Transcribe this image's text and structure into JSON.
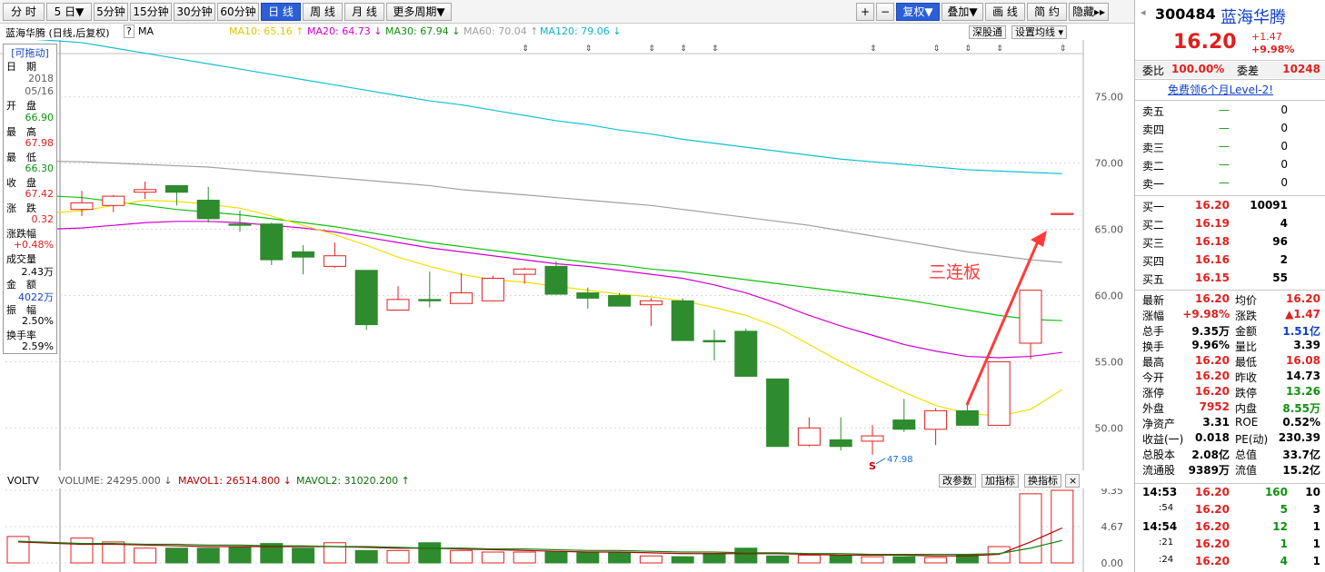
{
  "toolbar": {
    "periods": [
      "分 时",
      "5 日▼",
      "5分钟",
      "15分钟",
      "30分钟",
      "60分钟",
      "日 线",
      "周 线",
      "月 线",
      "更多周期▼"
    ],
    "active_period": 6,
    "right_buttons": [
      "+",
      "−",
      "复权▼",
      "叠加▼",
      "画 线",
      "简 约",
      "隐藏▸▸"
    ]
  },
  "stock": {
    "code": "300484",
    "name": "蓝海华腾",
    "price": "16.20",
    "change": "+1.47",
    "change_pct": "+9.98%"
  },
  "chart_header": {
    "title": "蓝海华腾 (日线,后复权)",
    "question": "?",
    "ma_label": "MA",
    "ma10": "MA10: 65.16 ↑",
    "ma20": "MA20: 64.73 ↓",
    "ma30": "MA30: 67.94 ↓",
    "ma60": "MA60: 70.04 ↑",
    "ma120": "MA120: 79.06 ↓",
    "btn_shengu": "深股通",
    "btn_ma_settings": "设置均线 ▾"
  },
  "info_panel": {
    "title": "[可拖动]",
    "date_label": "日　期",
    "year": "2018",
    "date": "05/16",
    "open_label": "开　盘",
    "open": "66.90",
    "high_label": "最　高",
    "high": "67.98",
    "low_label": "最　低",
    "low": "66.30",
    "close_label": "收　盘",
    "close": "67.42",
    "chg_label": "涨　跌",
    "chg": "0.32",
    "chgpct_label": "涨跌幅",
    "chgpct": "+0.48%",
    "vol_label": "成交量",
    "vol": "2.43万",
    "amt_label": "金　额",
    "amt": "4022万",
    "amp_label": "振　幅",
    "amp": "2.50%",
    "turn_label": "换手率",
    "turn": "2.59%"
  },
  "annotation": {
    "text": "三连板",
    "low_marker": "47.98",
    "s_marker": "S"
  },
  "vol_header": {
    "voltv": "VOLTV",
    "volume": "VOLUME: 24295.000 ↓",
    "mavol1": "MAVOL1: 26514.800 ↓",
    "mavol2": "MAVOL2: 31020.200 ↑",
    "btn_params": "改参数",
    "btn_add": "加指标",
    "btn_switch": "换指标",
    "btn_close": "×"
  },
  "colors": {
    "up": "#e0201e",
    "down": "#2e8b2e",
    "ma10": "#f0e000",
    "ma20": "#d000d0",
    "ma30": "#10c010",
    "ma60": "#a0a0a0",
    "ma120": "#10c0d0"
  },
  "chart_data": {
    "type": "candlestick",
    "y_ticks": [
      "75.00",
      "70.00",
      "65.00",
      "60.00",
      "55.00",
      "50.00"
    ],
    "ylim": [
      46.8,
      79.3
    ],
    "vol_ticks": [
      "9.35",
      "4.67",
      "0.00"
    ],
    "vol_ylim": [
      0,
      9.35
    ],
    "candles": [
      {
        "o": 66.5,
        "c": 67.0,
        "h": 67.9,
        "l": 66.0
      },
      {
        "o": 66.8,
        "c": 67.5,
        "h": 67.6,
        "l": 66.3
      },
      {
        "o": 67.8,
        "c": 68.0,
        "h": 68.6,
        "l": 67.3
      },
      {
        "o": 68.3,
        "c": 67.8,
        "h": 68.3,
        "l": 66.8
      },
      {
        "o": 67.2,
        "c": 65.8,
        "h": 68.2,
        "l": 65.5
      },
      {
        "o": 65.4,
        "c": 65.3,
        "h": 66.4,
        "l": 64.8
      },
      {
        "o": 65.4,
        "c": 62.7,
        "h": 65.5,
        "l": 62.3
      },
      {
        "o": 63.3,
        "c": 62.9,
        "h": 63.8,
        "l": 61.6
      },
      {
        "o": 62.2,
        "c": 63.0,
        "h": 64.0,
        "l": 62.1
      },
      {
        "o": 61.9,
        "c": 57.8,
        "h": 61.9,
        "l": 57.4
      },
      {
        "o": 58.9,
        "c": 59.7,
        "h": 60.7,
        "l": 58.9
      },
      {
        "o": 59.7,
        "c": 59.6,
        "h": 61.8,
        "l": 59.1
      },
      {
        "o": 59.4,
        "c": 60.2,
        "h": 61.7,
        "l": 59.4
      },
      {
        "o": 59.6,
        "c": 61.3,
        "h": 61.5,
        "l": 59.6
      },
      {
        "o": 61.6,
        "c": 62.0,
        "h": 62.1,
        "l": 60.9
      },
      {
        "o": 62.2,
        "c": 60.1,
        "h": 62.6,
        "l": 60.1
      },
      {
        "o": 60.2,
        "c": 59.8,
        "h": 60.6,
        "l": 59.0
      },
      {
        "o": 60.0,
        "c": 59.2,
        "h": 60.2,
        "l": 59.2
      },
      {
        "o": 59.3,
        "c": 59.6,
        "h": 59.8,
        "l": 57.7
      },
      {
        "o": 59.6,
        "c": 56.6,
        "h": 59.8,
        "l": 56.6
      },
      {
        "o": 56.6,
        "c": 56.5,
        "h": 57.4,
        "l": 55.1
      },
      {
        "o": 57.3,
        "c": 53.9,
        "h": 57.5,
        "l": 53.9
      },
      {
        "o": 53.7,
        "c": 48.6,
        "h": 53.7,
        "l": 48.6
      },
      {
        "o": 48.7,
        "c": 50.0,
        "h": 50.8,
        "l": 48.6
      },
      {
        "o": 49.1,
        "c": 48.6,
        "h": 50.8,
        "l": 48.3
      },
      {
        "o": 49.0,
        "c": 49.4,
        "h": 50.2,
        "l": 47.98
      },
      {
        "o": 50.6,
        "c": 49.9,
        "h": 52.2,
        "l": 49.7
      },
      {
        "o": 49.9,
        "c": 51.3,
        "h": 51.5,
        "l": 48.7
      },
      {
        "o": 51.3,
        "c": 50.2,
        "h": 51.8,
        "l": 50.2
      },
      {
        "o": 50.2,
        "c": 55.0,
        "h": 55.0,
        "l": 50.2
      },
      {
        "o": 56.4,
        "c": 60.4,
        "h": 60.4,
        "l": 55.2
      },
      {
        "o": 66.2,
        "c": 66.2,
        "h": 66.2,
        "l": 66.2
      }
    ],
    "volumes": [
      3.2,
      2.7,
      1.9,
      1.9,
      1.9,
      2.1,
      2.5,
      1.9,
      2.6,
      1.6,
      1.6,
      2.6,
      1.6,
      1.4,
      1.4,
      1.4,
      1.3,
      1.3,
      0.9,
      0.8,
      1.2,
      1.9,
      0.9,
      1.0,
      1.0,
      0.8,
      0.8,
      0.7,
      1.1,
      2.1,
      8.9,
      9.35
    ],
    "ma10": [
      66.4,
      66.8,
      67.2,
      67.1,
      66.9,
      66.6,
      66.0,
      65.3,
      64.6,
      63.8,
      62.9,
      62.2,
      61.6,
      61.2,
      61.0,
      60.7,
      60.4,
      60.1,
      59.9,
      59.6,
      59.1,
      58.5,
      57.6,
      56.3,
      55.0,
      53.8,
      52.7,
      51.7,
      51.1,
      50.9,
      51.4,
      52.9
    ],
    "ma20": [
      65.1,
      65.3,
      65.5,
      65.6,
      65.6,
      65.5,
      65.3,
      65.1,
      64.8,
      64.4,
      64.0,
      63.6,
      63.3,
      63.0,
      62.7,
      62.4,
      62.2,
      61.9,
      61.6,
      61.3,
      60.8,
      60.2,
      59.4,
      58.5,
      57.7,
      57.0,
      56.3,
      55.8,
      55.4,
      55.3,
      55.4,
      55.7
    ],
    "ma30": [
      67.4,
      67.1,
      66.8,
      66.5,
      66.3,
      66.1,
      65.8,
      65.5,
      65.2,
      64.8,
      64.4,
      64.0,
      63.7,
      63.4,
      63.1,
      62.8,
      62.5,
      62.3,
      62.0,
      61.8,
      61.5,
      61.2,
      60.9,
      60.6,
      60.3,
      60.0,
      59.7,
      59.3,
      58.9,
      58.5,
      58.2,
      58.1
    ],
    "ma60": [
      70.1,
      70.0,
      69.9,
      69.8,
      69.7,
      69.5,
      69.3,
      69.1,
      68.9,
      68.7,
      68.5,
      68.3,
      68.0,
      67.8,
      67.6,
      67.4,
      67.2,
      67.0,
      66.8,
      66.5,
      66.2,
      65.9,
      65.6,
      65.3,
      64.9,
      64.5,
      64.1,
      63.7,
      63.3,
      63.0,
      62.7,
      62.5
    ],
    "ma120": [
      79.1,
      78.7,
      78.3,
      77.9,
      77.5,
      77.1,
      76.7,
      76.3,
      75.9,
      75.5,
      75.1,
      74.7,
      74.4,
      74.0,
      73.6,
      73.2,
      72.9,
      72.5,
      72.2,
      71.8,
      71.5,
      71.2,
      70.9,
      70.6,
      70.3,
      70.1,
      69.9,
      69.7,
      69.5,
      69.4,
      69.3,
      69.2
    ],
    "mavol1": [
      2.4,
      2.4,
      2.3,
      2.2,
      2.1,
      2.1,
      2.1,
      2.1,
      2.1,
      2.0,
      1.9,
      1.9,
      1.8,
      1.7,
      1.6,
      1.5,
      1.4,
      1.4,
      1.3,
      1.2,
      1.2,
      1.2,
      1.2,
      1.1,
      1.0,
      1.0,
      1.0,
      0.9,
      0.9,
      1.1,
      2.7,
      4.5
    ],
    "mavol2": [
      2.5,
      2.5,
      2.4,
      2.4,
      2.3,
      2.3,
      2.2,
      2.2,
      2.1,
      2.1,
      2.0,
      1.9,
      1.9,
      1.8,
      1.8,
      1.7,
      1.6,
      1.6,
      1.5,
      1.4,
      1.4,
      1.3,
      1.3,
      1.2,
      1.2,
      1.1,
      1.1,
      1.1,
      1.1,
      1.2,
      1.9,
      2.9
    ]
  },
  "quote": {
    "weibi_label": "委比",
    "weibi": "100.00%",
    "weicha_label": "委差",
    "weicha": "10248",
    "level2": "免费领6个月Level-2!",
    "sell": [
      {
        "label": "卖五",
        "price": "—",
        "vol": "0"
      },
      {
        "label": "卖四",
        "price": "—",
        "vol": "0"
      },
      {
        "label": "卖三",
        "price": "—",
        "vol": "0"
      },
      {
        "label": "卖二",
        "price": "—",
        "vol": "0"
      },
      {
        "label": "卖一",
        "price": "—",
        "vol": "0"
      }
    ],
    "buy": [
      {
        "label": "买一",
        "price": "16.20",
        "vol": "10091"
      },
      {
        "label": "买二",
        "price": "16.19",
        "vol": "4"
      },
      {
        "label": "买三",
        "price": "16.18",
        "vol": "96"
      },
      {
        "label": "买四",
        "price": "16.16",
        "vol": "2"
      },
      {
        "label": "买五",
        "price": "16.15",
        "vol": "55"
      }
    ],
    "stats": [
      {
        "l1": "最新",
        "v1": "16.20",
        "c1": "red",
        "l2": "均价",
        "v2": "16.20",
        "c2": "red"
      },
      {
        "l1": "涨幅",
        "v1": "+9.98%",
        "c1": "red",
        "l2": "涨跌",
        "v2": "▲1.47",
        "c2": "red"
      },
      {
        "l1": "总手",
        "v1": "9.35万",
        "c1": "",
        "l2": "金额",
        "v2": "1.51亿",
        "c2": "blue"
      },
      {
        "l1": "换手",
        "v1": "9.96%",
        "c1": "",
        "l2": "量比",
        "v2": "3.39",
        "c2": ""
      },
      {
        "l1": "最高",
        "v1": "16.20",
        "c1": "red",
        "l2": "最低",
        "v2": "16.08",
        "c2": "red"
      },
      {
        "l1": "今开",
        "v1": "16.20",
        "c1": "red",
        "l2": "昨收",
        "v2": "14.73",
        "c2": ""
      },
      {
        "l1": "涨停",
        "v1": "16.20",
        "c1": "red",
        "l2": "跌停",
        "v2": "13.26",
        "c2": "green"
      },
      {
        "l1": "外盘",
        "v1": "7952",
        "c1": "red",
        "l2": "内盘",
        "v2": "8.55万",
        "c2": "green"
      },
      {
        "l1": "净资产",
        "v1": "3.31",
        "c1": "",
        "l2": "ROE",
        "v2": "0.52%",
        "c2": ""
      },
      {
        "l1": "收益(一)",
        "v1": "0.018",
        "c1": "",
        "l2": "PE(动)",
        "v2": "230.39",
        "c2": ""
      },
      {
        "l1": "总股本",
        "v1": "2.08亿",
        "c1": "",
        "l2": "总值",
        "v2": "33.7亿",
        "c2": ""
      },
      {
        "l1": "流通股",
        "v1": "9389万",
        "c1": "",
        "l2": "流值",
        "v2": "15.2亿",
        "c2": ""
      }
    ],
    "ticks": [
      {
        "t": "14:53",
        "p": "16.20",
        "v": "160",
        "n": "10",
        "bold": true
      },
      {
        "t": ":54",
        "p": "16.20",
        "v": "5",
        "n": "3",
        "bold": false
      },
      {
        "t": "14:54",
        "p": "16.20",
        "v": "12",
        "n": "1",
        "bold": true
      },
      {
        "t": ":21",
        "p": "16.20",
        "v": "1",
        "n": "1",
        "bold": false
      },
      {
        "t": ":24",
        "p": "16.20",
        "v": "4",
        "n": "1",
        "bold": false
      }
    ]
  }
}
